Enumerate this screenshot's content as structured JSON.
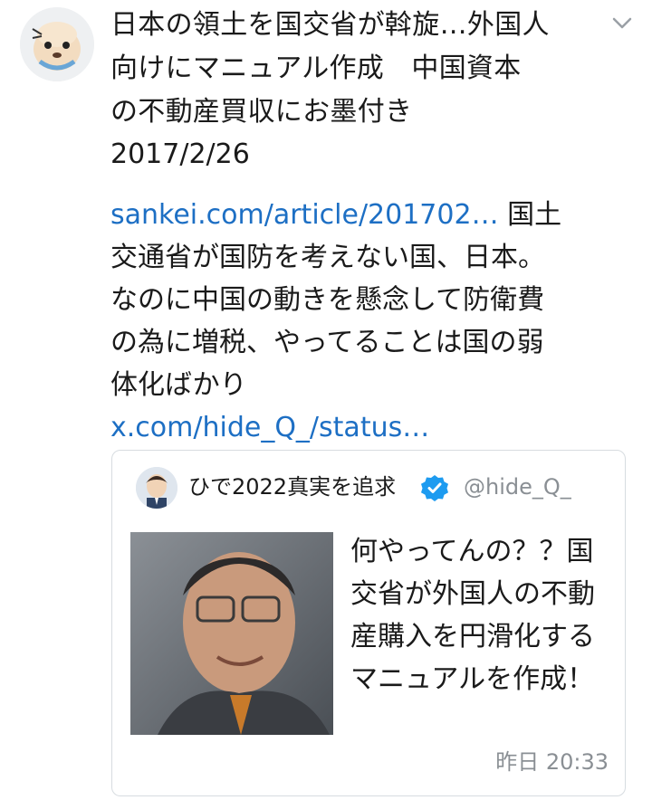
{
  "tweet": {
    "headline": "日本の領土を国交省が斡旋…外国人\n向けにマニュアル作成　中国資本\nの不動産買収にお墨付き",
    "date": "2017/2/26",
    "link_text": "sankei.com/article/201702…",
    "body_text": " 国土交通省が国防を考えない国、日本。なのに中国の動きを懸念して防衛費の為に増税、やってることは国の弱体化ばかり",
    "status_link": "x.com/hide_Q_/status…"
  },
  "quote": {
    "display_name": "ひで2022真実を追求",
    "handle": "@hide_Q_",
    "text": "何やってんの？？国交省が外国人の不動産購入を円滑化する マニュアルを作成！",
    "timestamp": "昨日 20:33"
  },
  "icons": {
    "menu": "chevron-down-icon",
    "verified": "verified-badge-icon"
  },
  "colors": {
    "link": "#1d6fc4",
    "verified": "#1d9bf0",
    "muted": "#8a8f94"
  }
}
